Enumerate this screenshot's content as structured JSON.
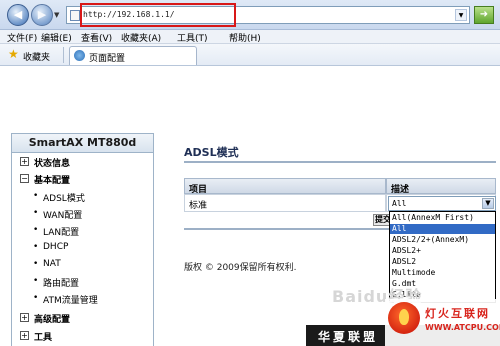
{
  "browser": {
    "address": "http://192.168.1.1/",
    "menu": [
      "文件(F)",
      "编辑(E)",
      "查看(V)",
      "收藏夹(A)",
      "工具(T)",
      "帮助(H)"
    ],
    "favorites_label": "收藏夹",
    "tab_title": "页面配置"
  },
  "sidebar": {
    "title": "SmartAX MT880d",
    "groups": [
      {
        "label": "状态信息",
        "expanded": false
      },
      {
        "label": "基本配置",
        "expanded": true,
        "items": [
          "ADSL模式",
          "WAN配置",
          "LAN配置",
          "DHCP",
          "NAT",
          "路由配置",
          "ATM流量管理"
        ]
      },
      {
        "label": "高级配置",
        "expanded": false
      },
      {
        "label": "工具",
        "expanded": false
      }
    ]
  },
  "main": {
    "heading": "ADSL模式",
    "table": {
      "headers": [
        "项目",
        "描述"
      ],
      "row_label": "标准",
      "selected_value": "All"
    },
    "submit_label": "提交",
    "dropdown_options": [
      "All(AnnexM First)",
      "All",
      "ADSL2/2+(AnnexM)",
      "ADSL2+",
      "ADSL2",
      "Multimode",
      "G.dmt",
      "G.lite"
    ],
    "dropdown_selected_index": 1,
    "copyright": "版权 © 2009保留所有权利."
  },
  "watermark": {
    "baidu": "Baidu经验",
    "banner": "华夏联盟",
    "logo_cn": "灯火互联网",
    "logo_url": "WWW.ATCPU.COM"
  },
  "colors": {
    "address_highlight": "#d81818",
    "selected_option": "#316ac5",
    "logo_red": "#d8241c"
  }
}
